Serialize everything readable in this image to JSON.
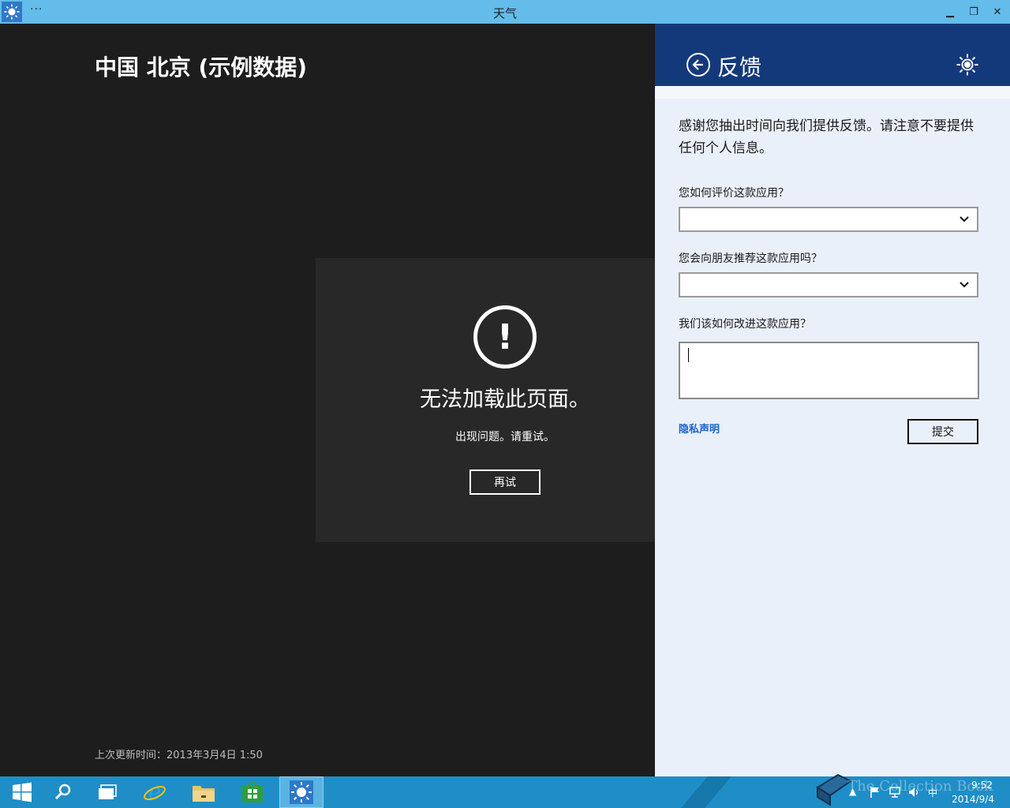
{
  "window": {
    "title": "天气",
    "menu": "···",
    "minimize": "▁",
    "restore": "❐",
    "close": "✕"
  },
  "app": {
    "city_title": "中国 北京 (示例数据)",
    "last_update": "上次更新时间：2013年3月4日 1:50",
    "error": {
      "icon": "!",
      "title": "无法加载此页面。",
      "subtitle": "出现问题。请重试。",
      "retry_label": "再试"
    }
  },
  "feedback": {
    "title": "反馈",
    "intro": "感谢您抽出时间向我们提供反馈。请注意不要提供任何个人信息。",
    "q1": "您如何评价这款应用？",
    "q1_value": "",
    "q2": "您会向朋友推荐这款应用吗？",
    "q2_value": "",
    "q3": "我们该如何改进这款应用？",
    "q3_value": "",
    "privacy_link": "隐私声明",
    "submit_label": "提交"
  },
  "taskbar": {
    "items": [
      "windows-logo",
      "search-icon",
      "task-view-icon",
      "internet-explorer-icon",
      "file-explorer-icon",
      "store-icon",
      "weather-app-icon"
    ],
    "tray": {
      "ime": "中",
      "time": "9:52",
      "date": "2014/9/4",
      "watermark": "The Collection Book"
    }
  },
  "colors": {
    "titlebar": "#63bce9",
    "pane_header": "#14397b",
    "pane_bg": "#eaf0f9",
    "taskbar": "#1f8ec6",
    "link": "#1a64c8"
  }
}
